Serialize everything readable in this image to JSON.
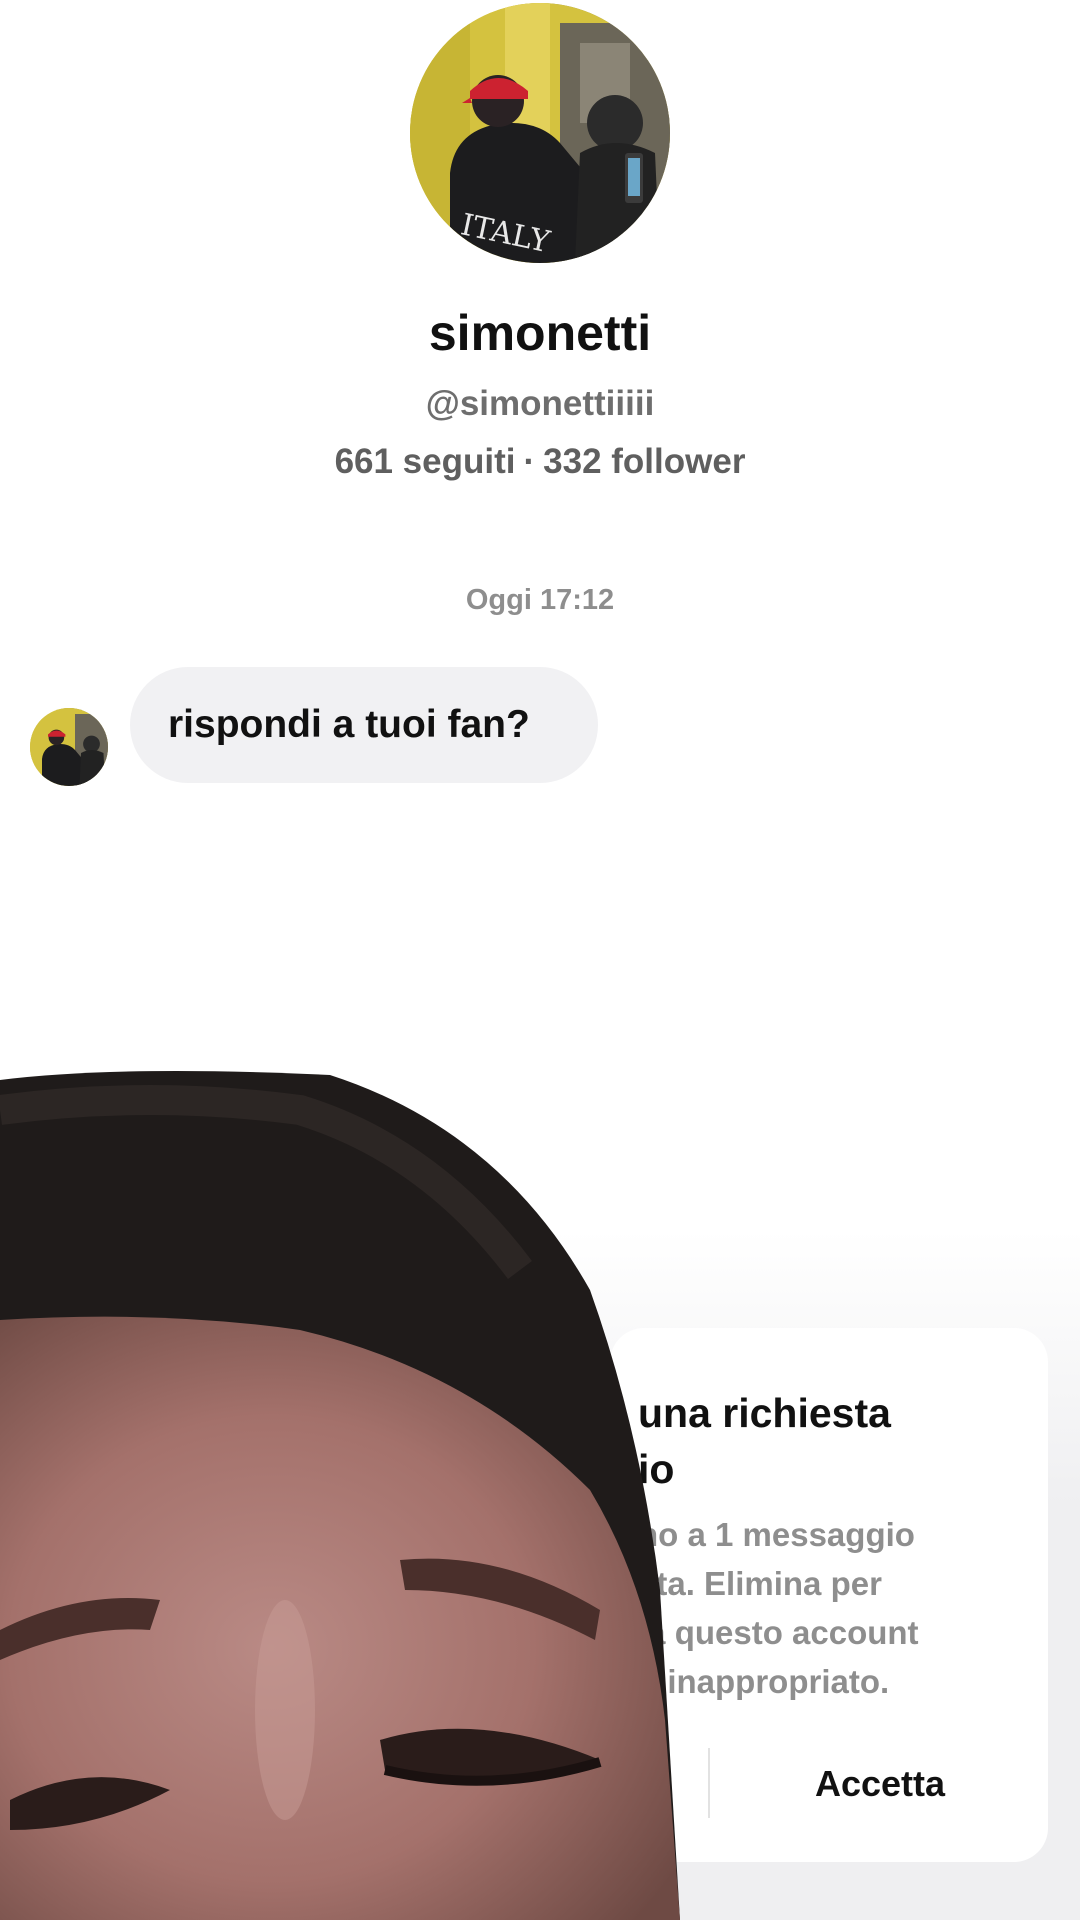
{
  "profile": {
    "display_name": "simonetti",
    "handle": "@simonettiiiii",
    "following": "661 seguiti",
    "separator": "·",
    "followers": "332 follower"
  },
  "chat": {
    "timestamp": "Oggi 17:12",
    "message": "rispondi a tuoi fan?"
  },
  "request_card": {
    "title_line1": "una richiesta",
    "title_line2": "io",
    "body_lines": [
      "no a 1 messaggio",
      "sta. Elimina per",
      "ia questo account",
      "o inappropriato."
    ],
    "accept_label": "Accetta"
  },
  "colors": {
    "bubble": "#f1f1f3",
    "secondary_text": "#8e8e8e",
    "avatar_wall": "#d9c544"
  }
}
